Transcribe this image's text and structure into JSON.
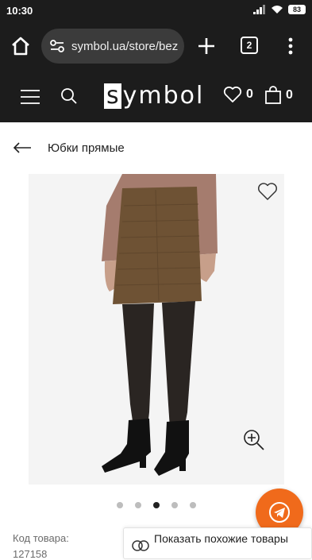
{
  "status_bar": {
    "time": "10:30",
    "battery": "83",
    "icons": [
      "signal-icon",
      "wifi-icon",
      "battery-icon"
    ]
  },
  "browser": {
    "url": "symbol.ua/store/bez",
    "tab_count": "2"
  },
  "site_header": {
    "logo_letter": "s",
    "logo_rest": "ymbol",
    "favorites_count": "0",
    "cart_count": "0"
  },
  "breadcrumb": {
    "title": "Юбки прямые"
  },
  "gallery": {
    "slides": 5,
    "active_index": 2
  },
  "product": {
    "sku_label": "Код товара:",
    "sku_value": "127158"
  },
  "similar": {
    "label": "Показать похожие товары"
  },
  "colors": {
    "header_bg": "#1c1c1c",
    "accent": "#f06a1b",
    "image_bg": "#f4f4f4"
  }
}
